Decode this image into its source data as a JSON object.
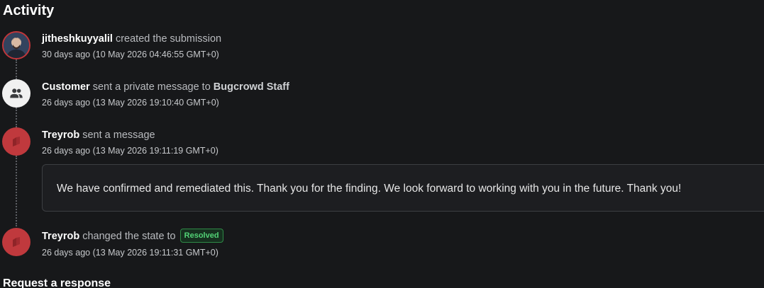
{
  "section_title": "Activity",
  "events": [
    {
      "actor": "jitheshkuyyalil",
      "action": "created the submission",
      "time": "30 days ago (10 May 2026 04:46:55 GMT+0)",
      "avatar_type": "user-photo"
    },
    {
      "actor": "Customer",
      "action": "sent a private message to",
      "target": "Bugcrowd Staff",
      "time": "26 days ago (13 May 2026 19:10:40 GMT+0)",
      "avatar_type": "group-icon"
    },
    {
      "actor": "Treyrob",
      "action": "sent a message",
      "time": "26 days ago (13 May 2026 19:11:19 GMT+0)",
      "avatar_type": "brand-logo",
      "message": "We have confirmed and remediated this. Thank you for the finding. We look forward to working with you in the future. Thank you!"
    },
    {
      "actor": "Treyrob",
      "action": "changed the state to",
      "state": "Resolved",
      "time": "26 days ago (13 May 2026 19:11:31 GMT+0)",
      "avatar_type": "brand-logo"
    }
  ],
  "next_section_title": "Request a response",
  "colors": {
    "background": "#17181a",
    "avatar_ring": "#c1363a",
    "brand_avatar": "#c0393d",
    "resolved_badge": "#52d276"
  }
}
